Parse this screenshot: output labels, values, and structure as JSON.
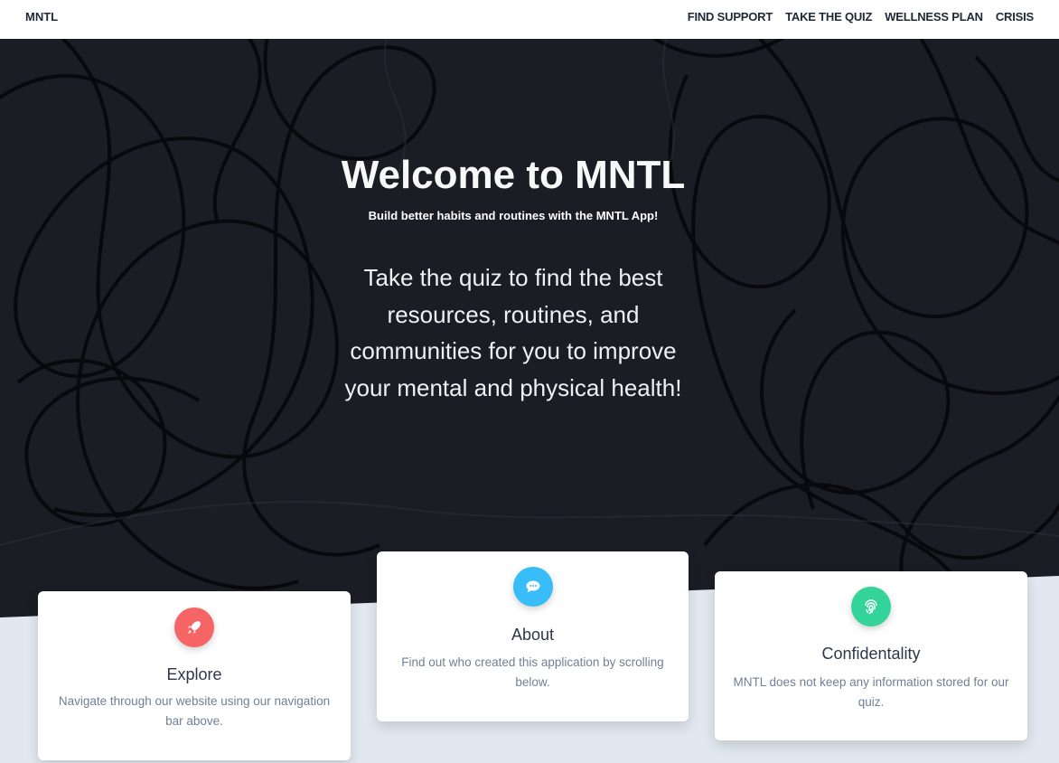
{
  "navbar": {
    "brand": "MNTL",
    "links": [
      "FIND SUPPORT",
      "TAKE THE QUIZ",
      "WELLNESS PLAN",
      "CRISIS"
    ]
  },
  "hero": {
    "title": "Welcome to MNTL",
    "subtitle": "Build better habits and routines with the MNTL App!",
    "body": "Take the quiz to find the best resources, routines, and communities for you to improve your mental and physical health!"
  },
  "cards": [
    {
      "title": "Explore",
      "text": "Navigate through our website using our navigation bar above.",
      "icon": "rocket-icon",
      "color": "#f56565"
    },
    {
      "title": "About",
      "text": "Find out who created this application by scrolling below.",
      "icon": "chat-bubble-icon",
      "color": "#38bdf8"
    },
    {
      "title": "Confidentality",
      "text": "MNTL does not keep any information stored for our quiz.",
      "icon": "fingerprint-icon",
      "color": "#34d399"
    }
  ],
  "colors": {
    "hero_background": "#1b1d24",
    "page_background": "#e2e8f0",
    "nav_text": "#1f2937"
  }
}
